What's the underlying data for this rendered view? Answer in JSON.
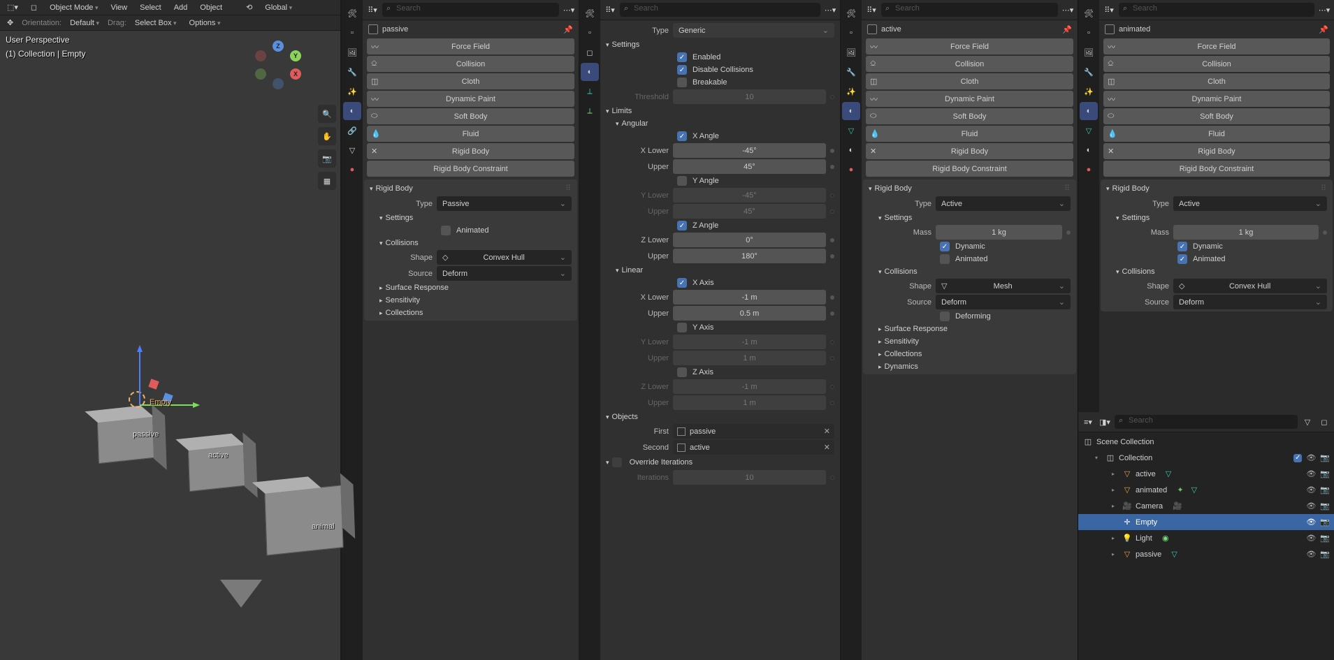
{
  "header": {
    "mode": "Object Mode",
    "menus": [
      "View",
      "Select",
      "Add",
      "Object"
    ],
    "orientation": "Global",
    "orientation_label": "Orientation:",
    "pivot": "Default",
    "drag_label": "Drag:",
    "drag_mode": "Select Box",
    "options": "Options"
  },
  "viewport": {
    "persp": "User Perspective",
    "path": "(1) Collection | Empty",
    "objects": {
      "empty": "Empty",
      "passive": "passive",
      "active": "active",
      "animated": "animal"
    },
    "axes": {
      "x": "X",
      "y": "Y",
      "z": "Z"
    }
  },
  "search_placeholder": "Search",
  "physics_buttons": [
    "Force Field",
    "Collision",
    "Cloth",
    "Dynamic Paint",
    "Soft Body",
    "Fluid",
    "Rigid Body",
    "Rigid Body Constraint"
  ],
  "panel1": {
    "crumb": "passive",
    "rigidbody_h": "Rigid Body",
    "type_label": "Type",
    "type": "Passive",
    "settings_h": "Settings",
    "animated": "Animated",
    "animated_on": false,
    "collisions_h": "Collisions",
    "shape_label": "Shape",
    "shape": "Convex Hull",
    "source_label": "Source",
    "source": "Deform",
    "surface_h": "Surface Response",
    "sensitivity_h": "Sensitivity",
    "collections_h": "Collections"
  },
  "panel2": {
    "type_label": "Type",
    "type": "Generic",
    "settings_h": "Settings",
    "enabled": "Enabled",
    "enabled_on": true,
    "disable_col": "Disable Collisions",
    "disable_col_on": true,
    "breakable": "Breakable",
    "breakable_on": false,
    "threshold_label": "Threshold",
    "threshold": "10",
    "limits_h": "Limits",
    "angular_h": "Angular",
    "x_angle": "X Angle",
    "x_angle_on": true,
    "x_lower_label": "X Lower",
    "x_lower": "-45°",
    "x_upper_label": "Upper",
    "x_upper": "45°",
    "y_angle": "Y Angle",
    "y_angle_on": false,
    "y_lower_label": "Y Lower",
    "y_lower": "-45°",
    "y_upper_label": "Upper",
    "y_upper": "45°",
    "z_angle": "Z Angle",
    "z_angle_on": true,
    "z_lower_label": "Z Lower",
    "z_lower": "0°",
    "z_upper_label": "Upper",
    "z_upper": "180°",
    "linear_h": "Linear",
    "x_axis": "X Axis",
    "x_axis_on": true,
    "lx_lower_label": "X Lower",
    "lx_lower": "-1 m",
    "lx_upper_label": "Upper",
    "lx_upper": "0.5 m",
    "y_axis": "Y Axis",
    "y_axis_on": false,
    "ly_lower_label": "Y Lower",
    "ly_lower": "-1 m",
    "ly_upper_label": "Upper",
    "ly_upper": "1 m",
    "z_axis": "Z Axis",
    "z_axis_on": false,
    "lz_lower_label": "Z Lower",
    "lz_lower": "-1 m",
    "lz_upper_label": "Upper",
    "lz_upper": "1 m",
    "objects_h": "Objects",
    "first_label": "First",
    "first": "passive",
    "second_label": "Second",
    "second": "active",
    "override_h": "Override Iterations",
    "override_on": false,
    "iter_label": "Iterations",
    "iter": "10"
  },
  "panel3": {
    "crumb": "active",
    "rigidbody_h": "Rigid Body",
    "type_label": "Type",
    "type": "Active",
    "settings_h": "Settings",
    "mass_label": "Mass",
    "mass": "1 kg",
    "dynamic": "Dynamic",
    "dynamic_on": true,
    "animated": "Animated",
    "animated_on": false,
    "collisions_h": "Collisions",
    "shape_label": "Shape",
    "shape": "Mesh",
    "source_label": "Source",
    "source": "Deform",
    "deforming": "Deforming",
    "deforming_on": false,
    "surface_h": "Surface Response",
    "sensitivity_h": "Sensitivity",
    "collections_h": "Collections",
    "dynamics_h": "Dynamics"
  },
  "panel4": {
    "crumb": "animated",
    "rigidbody_h": "Rigid Body",
    "type_label": "Type",
    "type": "Active",
    "settings_h": "Settings",
    "mass_label": "Mass",
    "mass": "1 kg",
    "dynamic": "Dynamic",
    "dynamic_on": true,
    "animated": "Animated",
    "animated_on": true,
    "collisions_h": "Collisions",
    "shape_label": "Shape",
    "shape": "Convex Hull",
    "source_label": "Source",
    "source": "Deform"
  },
  "outliner": {
    "scene": "Scene Collection",
    "coll": "Collection",
    "items": [
      {
        "name": "active"
      },
      {
        "name": "animated"
      },
      {
        "name": "Camera"
      },
      {
        "name": "Empty"
      },
      {
        "name": "Light"
      },
      {
        "name": "passive"
      }
    ]
  }
}
